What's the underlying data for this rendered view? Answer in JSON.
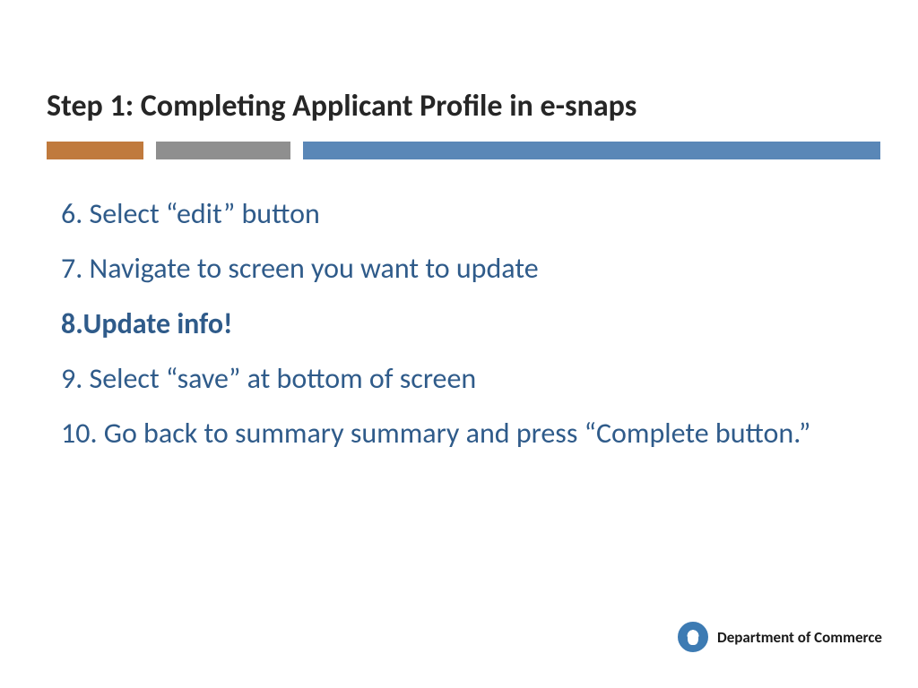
{
  "title": "Step 1: Completing Applicant Profile in e-snaps",
  "colors": {
    "bar1": "#c07a3d",
    "bar2": "#8f8f8f",
    "bar3": "#5a87b7",
    "body_text": "#2f5b8a"
  },
  "items": [
    {
      "text": "6. Select “edit” button",
      "bold": false
    },
    {
      "text": "7. Navigate to screen you want to update",
      "bold": false
    },
    {
      "text": "8.Update info!",
      "bold": true
    },
    {
      "text": "9. Select “save” at bottom of screen",
      "bold": false
    },
    {
      "text": "10. Go back to summary summary and press “Complete button.”",
      "bold": false
    }
  ],
  "footer": {
    "org": "Department of Commerce"
  }
}
